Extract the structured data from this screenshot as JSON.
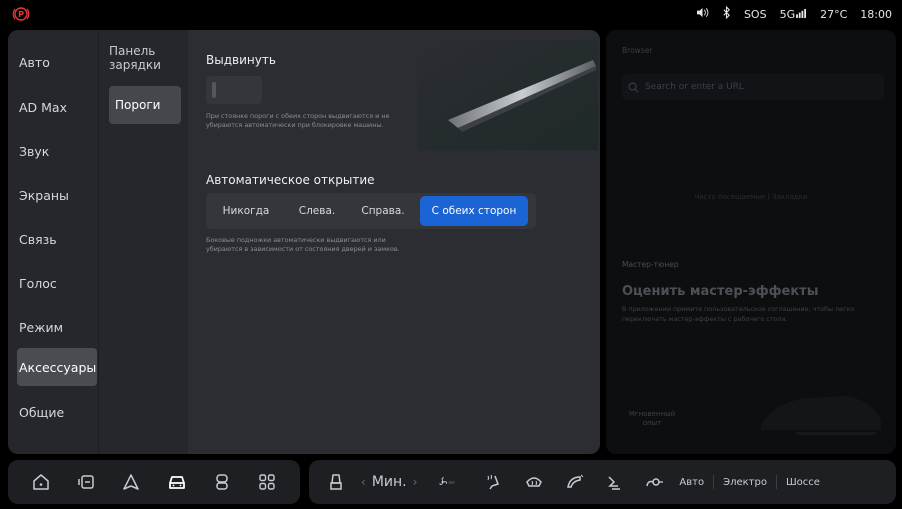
{
  "status": {
    "left_icon": "p-circle-warning-icon",
    "volume_icon": "speaker-icon",
    "bluetooth_icon": "bluetooth-icon",
    "sos": "SOS",
    "network": "5G",
    "temperature": "27°C",
    "time": "18:00",
    "accent_color": "#e53935"
  },
  "nav1": [
    {
      "label": "Авто"
    },
    {
      "label": "AD Max"
    },
    {
      "label": "Звук"
    },
    {
      "label": "Экраны"
    },
    {
      "label": "Связь"
    },
    {
      "label": "Голос"
    },
    {
      "label": "Режим"
    },
    {
      "label": "Аксессуары"
    },
    {
      "label": "Общие"
    }
  ],
  "nav2": [
    {
      "label": "Панель зарядки"
    },
    {
      "label": "Пороги"
    }
  ],
  "content": {
    "extend_title": "Выдвинуть",
    "extend_hint": "При стоянке пороги с обеих сторон выдвигаются и не убираются автоматически при блокировке машины.",
    "auto_title": "Автоматическое открытие",
    "segments": [
      "Никогда",
      "Слева.",
      "Справа.",
      "С обеих сторон"
    ],
    "selected_segment": 3,
    "auto_hint": "Боковые подножки автоматически выдвигаются или убираются в зависимости от состояния дверей и замков."
  },
  "right_card": {
    "browser_label": "Browser",
    "search_placeholder": "Search or enter a URL",
    "faint_center": "Часто посещаемые | Закладки",
    "master_label": "Мастер-тюнер",
    "master_title": "Оценить мастер-эффекты",
    "master_desc": "В приложении примите пользовательское соглашение, чтобы легко переключать мастер-эффекты с рабочего стола.",
    "instant": "Мгновенный опыт"
  },
  "dock": {
    "left_icons": [
      "home-icon",
      "media-icon",
      "navigation-icon",
      "car-icon",
      "seat-icon",
      "apps-grid-icon"
    ],
    "fan_label": "Мин.",
    "fan_off": "OFF",
    "modes": [
      "Авто",
      "Электро",
      "Шоссе"
    ]
  }
}
